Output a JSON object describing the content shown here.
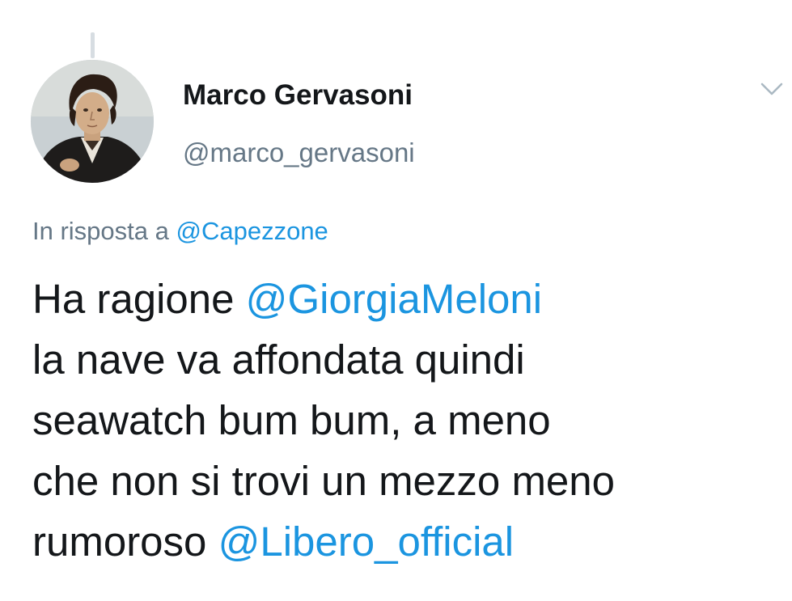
{
  "author": {
    "display_name": "Marco Gervasoni",
    "handle": "@marco_gervasoni"
  },
  "reply_context": {
    "prefix": "In risposta a",
    "mention": "@Capezzone"
  },
  "tweet": {
    "line1_text": "Ha ragione ",
    "line1_mention": "@GiorgiaMeloni",
    "line2": "la nave va affondata quindi",
    "line3": "seawatch bum bum, a meno",
    "line4": "che non si trovi un mezzo meno",
    "line5_text": "rumoroso ",
    "line5_mention": "@Libero_official"
  },
  "icons": {
    "menu": "chevron-down-icon",
    "avatar": "portrait-avatar"
  },
  "colors": {
    "text": "#14171a",
    "secondary": "#657786",
    "link": "#1b95e0",
    "thread_line": "#d7dde2"
  }
}
